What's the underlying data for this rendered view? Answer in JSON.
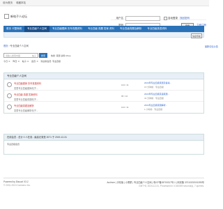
{
  "topbar": {
    "items": [
      "设为首页",
      "收藏本站"
    ]
  },
  "header": {
    "logo_text": "新电子人论坛",
    "login": {
      "user_label": "用户名",
      "pass_label": "密码",
      "auto_login": "自动登录",
      "find_pwd": "找回密码",
      "login_btn": "登录",
      "register": "立即注册"
    }
  },
  "nav": {
    "items": [
      "首页 卡盟商城",
      "专业四级个人空间",
      "专业四级题库 历年真题资料",
      "专业四级 真题 答案 资料",
      "专业四级真题及解析",
      "专业四级英语资料"
    ]
  },
  "subnav": {
    "btn": "快捷导航"
  },
  "breadcrumb": {
    "home": "首页",
    "items": [
      "专业四级个人空间"
    ]
  },
  "notice": "最新论坛公告",
  "search": {
    "placeholder": "请输入搜索内容",
    "scope": "帖子",
    "go": "搜索",
    "hot": "热搜: 真题 资料 Move"
  },
  "tabs": [
    "今日: 0",
    "昨日: 0",
    "帖子: 0",
    "会员: 0",
    "欢迎新会员: 专业四级"
  ],
  "forum": {
    "header": "专业四级个人空间",
    "rows": [
      {
        "title": "专业四级题库 历年真题资料",
        "desc": "发表专业四级题库帖子...",
        "stat": "104 / 11",
        "last": "2024年专业四级真题及答案...",
        "meta": "15 分钟前 · 专业四级"
      },
      {
        "title": "专业四级 真题 答案资料",
        "desc": "发表专业四级真题帖子...",
        "stat": "95 / 10",
        "last": "2024年专业四级英语真题...",
        "meta": "32 分钟前 · 专业四级"
      },
      {
        "title": "专业四级真题及解析",
        "desc": "发表专业四级解析帖子...",
        "stat": "104 / 11",
        "last": "2024专业四级真题解析...",
        "meta": "1 小时前 · 专业四级"
      }
    ]
  },
  "online": {
    "header": "在线会员 - 总计 0 人在线 - 最高记录是 2071 于 2019-12-31",
    "legend": "专业四级会员"
  },
  "footer": {
    "powered": "Powered by Discuz! X3.2",
    "copy": "© 2001-2013 Comsenz Inc.",
    "links": "Archiver | 手机版 | 小黑屋 | 专业四级个人空间 | 粤ICP备05700317号-1 | 网安备 37010202001395号",
    "gmt": "GMT+8, 2024-12-31, Processed in 0.040069 second(s), 7 queries."
  }
}
